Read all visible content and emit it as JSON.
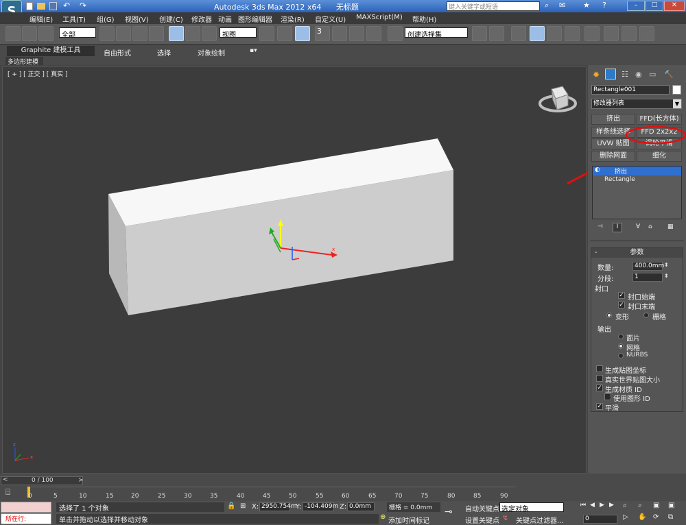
{
  "window": {
    "title": "Autodesk 3ds Max  2012 x64",
    "file": "无标题",
    "search_placeholder": "键入关键字或短语"
  },
  "menu": [
    "编辑(E)",
    "工具(T)",
    "组(G)",
    "视图(V)",
    "创建(C)",
    "修改器",
    "动画",
    "图形编辑器",
    "渲染(R)",
    "自定义(U)",
    "MAXScript(M)",
    "帮助(H)"
  ],
  "toolbar": {
    "filter": "全部",
    "refcoord": "视图",
    "snap_label": "3",
    "selection_set": "创建选择集"
  },
  "ribbon": {
    "tabs": [
      "Graphite 建模工具",
      "自由形式",
      "选择",
      "对象绘制"
    ],
    "sub": "多边形建模"
  },
  "viewport": {
    "label": "[ + ] [ 正交 ] [ 真实 ]",
    "axis_x": "x",
    "axis_y": "y",
    "axis_z": "z"
  },
  "cmdpanel": {
    "object_name": "Rectangle001",
    "modifier_list": "修改器列表",
    "buttons": [
      "挤出",
      "FFD(长方体)",
      "样条线选择",
      "FFD 2x2x2",
      "UVW 贴图",
      "涡轮平滑",
      "删除网面",
      "细化"
    ],
    "stack": [
      "挤出",
      "Rectangle"
    ],
    "rollout_title": "参数",
    "amount_label": "数量:",
    "amount": "400.0mm",
    "segments_label": "分段:",
    "segments": "1",
    "capping_group": "封口",
    "cap_start": "封口始端",
    "cap_end": "封口末端",
    "morph": "变形",
    "grid": "栅格",
    "output_group": "输出",
    "patch": "面片",
    "mesh": "网格",
    "nurbs": "NURBS",
    "gen_mapping": "生成贴图坐标",
    "real_world": "真实世界贴图大小",
    "gen_matid": "生成材质 ID",
    "use_shape_ids": "使用图形 ID",
    "smooth": "平滑"
  },
  "timeline": {
    "frame": "0 / 100",
    "ticks": [
      "0",
      "5",
      "10",
      "15",
      "20",
      "25",
      "30",
      "35",
      "40",
      "45",
      "50",
      "55",
      "60",
      "65",
      "70",
      "75",
      "80",
      "85",
      "90"
    ]
  },
  "status": {
    "maxscript": "所在行:",
    "selected": "选择了 1 个对象",
    "prompt": "单击并拖动以选择并移动对象",
    "x": "2950.754m",
    "y": "-104.409m",
    "z": "0.0mm",
    "grid": "栅格 = 0.0mm",
    "add_time_tag": "添加时间标记",
    "auto_key": "自动关键点",
    "set_key": "设置关键点",
    "selected_obj": "选定对象",
    "key_filters": "关键点过滤器...",
    "frame_field": "0"
  },
  "colors": {
    "accent": "#2f6fd0",
    "annotation": "#e01010",
    "box_top": "#f7f7f7",
    "box_front": "#cfcfcf",
    "box_side": "#b9b9b9"
  }
}
